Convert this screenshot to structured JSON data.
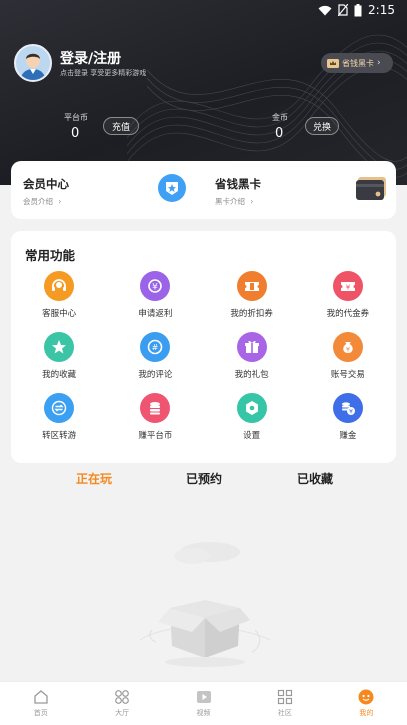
{
  "statusbar": {
    "time": "2:15"
  },
  "header": {
    "login_title": "登录/注册",
    "login_subtitle": "点击登录  享受更多精彩游戏",
    "vip_pill_label": "省钱黑卡",
    "platform_coin": {
      "label": "平台币",
      "value": "0",
      "button": "充值"
    },
    "gold_coin": {
      "label": "金币",
      "value": "0",
      "button": "兑换"
    }
  },
  "member": {
    "left_title": "会员中心",
    "left_sub": "会员介绍",
    "right_title": "省钱黑卡",
    "right_sub": "黑卡介绍"
  },
  "functions": {
    "title": "常用功能",
    "items": [
      {
        "label": "客服中心",
        "icon": "headset-icon",
        "color": "#f59a23"
      },
      {
        "label": "申请返利",
        "icon": "rebate-icon",
        "color": "#9a63e8"
      },
      {
        "label": "我的折扣券",
        "icon": "discount-ticket-icon",
        "color": "#f07e2e"
      },
      {
        "label": "我的代金券",
        "icon": "voucher-icon",
        "color": "#ee5466"
      },
      {
        "label": "我的收藏",
        "icon": "star-icon",
        "color": "#3cc4a6"
      },
      {
        "label": "我的评论",
        "icon": "comment-icon",
        "color": "#3a9df0"
      },
      {
        "label": "我的礼包",
        "icon": "gift-icon",
        "color": "#a866e6"
      },
      {
        "label": "账号交易",
        "icon": "money-bag-icon",
        "color": "#f38a3a"
      },
      {
        "label": "转区转游",
        "icon": "transfer-icon",
        "color": "#3b9ff2"
      },
      {
        "label": "赚平台币",
        "icon": "coins-icon",
        "color": "#ef5570"
      },
      {
        "label": "设置",
        "icon": "settings-icon",
        "color": "#35c6a8"
      },
      {
        "label": "赚金",
        "icon": "earn-gold-icon",
        "color": "#3f6fe8"
      }
    ]
  },
  "tabs": [
    {
      "label": "正在玩",
      "active": true
    },
    {
      "label": "已预约",
      "active": false
    },
    {
      "label": "已收藏",
      "active": false
    }
  ],
  "bottom_nav": [
    {
      "label": "首页",
      "icon": "home-icon",
      "active": false
    },
    {
      "label": "大厅",
      "icon": "hall-icon",
      "active": false
    },
    {
      "label": "视频",
      "icon": "video-icon",
      "active": false
    },
    {
      "label": "社区",
      "icon": "community-icon",
      "active": false
    },
    {
      "label": "我的",
      "icon": "profile-icon",
      "active": true
    }
  ],
  "colors": {
    "accent": "#f5891f",
    "header_bg": "#26272d"
  }
}
